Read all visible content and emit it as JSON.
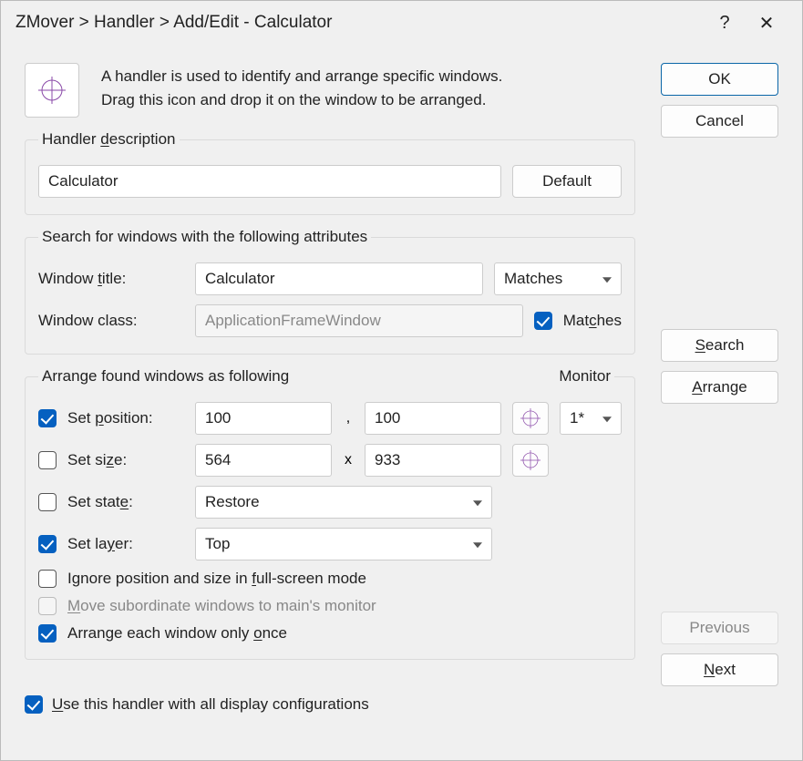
{
  "title": "ZMover > Handler > Add/Edit - Calculator",
  "intro": {
    "line1": "A handler is used to identify and arrange specific windows.",
    "line2": "Drag this icon and drop it on the window to be arranged."
  },
  "buttons": {
    "ok": "OK",
    "cancel": "Cancel",
    "search": "Search",
    "arrange": "Arrange",
    "previous": "Previous",
    "next": "Next",
    "default": "Default"
  },
  "description": {
    "legend": "Handler description",
    "value": "Calculator"
  },
  "search": {
    "legend": "Search for windows with the following attributes",
    "title_label": "Window title:",
    "title_value": "Calculator",
    "title_match": "Matches",
    "class_label": "Window class:",
    "class_value": "ApplicationFrameWindow",
    "class_match": "Matches"
  },
  "arrange_group": {
    "legend": "Arrange found windows as following",
    "monitor_label": "Monitor",
    "set_position": "Set position:",
    "pos_x": "100",
    "pos_y": "100",
    "monitor_value": "1*",
    "set_size": "Set size:",
    "size_w": "564",
    "size_h": "933",
    "set_state": "Set state:",
    "state_value": "Restore",
    "set_layer": "Set layer:",
    "layer_value": "Top",
    "ignore_fullscreen": "Ignore position and size in full-screen mode",
    "move_subordinate": "Move subordinate windows to main's monitor",
    "arrange_once": "Arrange each window only once"
  },
  "use_handler": "Use this handler with all display configurations",
  "separators": {
    "comma": ",",
    "x": "x"
  }
}
